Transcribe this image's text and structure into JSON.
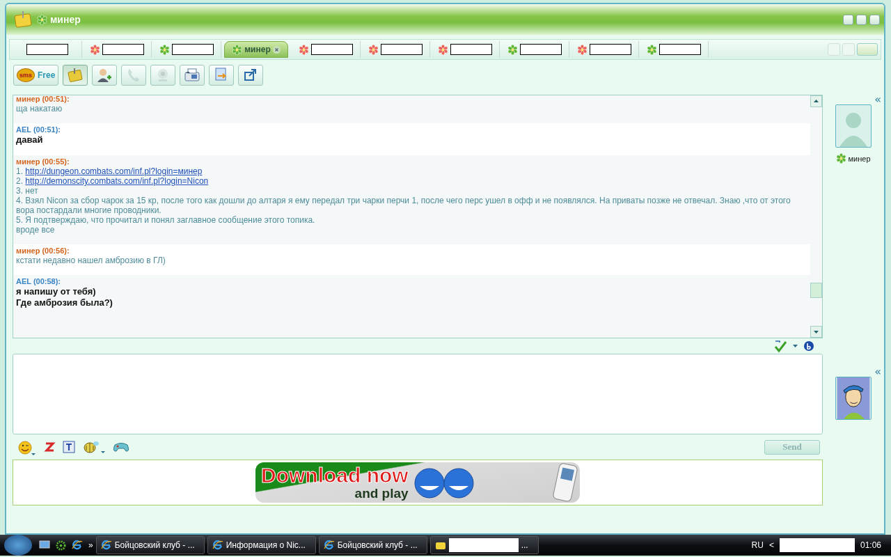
{
  "window": {
    "title": "минер",
    "color": "#5cb531"
  },
  "tabs": [
    {
      "selected": false
    },
    {
      "color": "#e8625a",
      "selected": false
    },
    {
      "color": "#5cb531",
      "selected": false
    },
    {
      "color": "#5cb531",
      "selected": true,
      "label": "минер"
    },
    {
      "color": "#e8625a",
      "selected": false
    },
    {
      "color": "#e8625a",
      "selected": false
    },
    {
      "color": "#e8625a",
      "selected": false
    },
    {
      "color": "#5cb531",
      "selected": false
    },
    {
      "color": "#e8625a",
      "selected": false
    },
    {
      "color": "#5cb531",
      "selected": false
    }
  ],
  "toolbar": [
    {
      "kind": "sms",
      "badge": "sms",
      "label": "Free",
      "pressed": false,
      "disabled": false
    },
    {
      "kind": "note",
      "pressed": true,
      "disabled": false
    },
    {
      "kind": "add-contact",
      "pressed": false,
      "disabled": false
    },
    {
      "kind": "phone",
      "pressed": false,
      "disabled": true
    },
    {
      "kind": "webcam",
      "pressed": false,
      "disabled": true
    },
    {
      "kind": "fax",
      "pressed": false,
      "disabled": false
    },
    {
      "kind": "file",
      "pressed": false,
      "disabled": false
    },
    {
      "kind": "popout",
      "pressed": false,
      "disabled": false
    }
  ],
  "messages": [
    {
      "kind": "them",
      "author": "минер",
      "time": "(00:51):",
      "lines": [
        {
          "text": "ща накатаю"
        }
      ]
    },
    {
      "kind": "me",
      "author": "AEL",
      "time": "(00:51):",
      "lines": [
        {
          "text": "давай"
        }
      ]
    },
    {
      "kind": "them",
      "author": "минер",
      "time": "(00:55):",
      "lines": [
        {
          "number": "1.",
          "link": "http://dungeon.combats.com/inf.pl?login=минер"
        },
        {
          "number": "2.",
          "link": "http://demonscity.combats.com/inf.pl?login=Nicon"
        },
        {
          "text": "3. нет"
        },
        {
          "text": "4. Взял Nicon за сбор чарок за 15 кр, после того как дошли до алтаря я ему передал три чарки перчи 1, после чего перс ушел в офф и не появлялся. На приваты позже не отвечал. Знаю ,что от этого вора постардали многие проводники."
        },
        {
          "text": "5. Я подтверждаю, что прочитал и понял заглавное сообщение этого топика."
        },
        {
          "text": "вроде все"
        }
      ]
    },
    {
      "kind": "them",
      "author": "минер",
      "time": "(00:56):",
      "lines": [
        {
          "text": "кстати недавно нашел амброзию в ГЛ)"
        }
      ]
    },
    {
      "kind": "me",
      "author": "AEL",
      "time": "(00:58):",
      "lines": [
        {
          "text": "я напишу от тебя)"
        },
        {
          "text": "Где амброзия была?)"
        }
      ]
    }
  ],
  "sidebar": {
    "contact_name": "минер",
    "color": "#5cb531",
    "collapse_glyph": "«",
    "own_collapse_glyph": "«"
  },
  "send_button": {
    "label": "Send",
    "disabled": true
  },
  "banner": {
    "headline": "Download now",
    "tagline": "and play"
  },
  "taskbar": {
    "overflow": "»",
    "tasks": [
      {
        "kind": "browser",
        "title": "Бойцовский клуб - ..."
      },
      {
        "kind": "browser",
        "title": "Информация о Nic..."
      },
      {
        "kind": "browser",
        "title": "Бойцовский клуб - ..."
      },
      {
        "kind": "messenger",
        "title": "..."
      }
    ],
    "language": "RU",
    "tray_expand": "<",
    "clock": "01:06"
  }
}
